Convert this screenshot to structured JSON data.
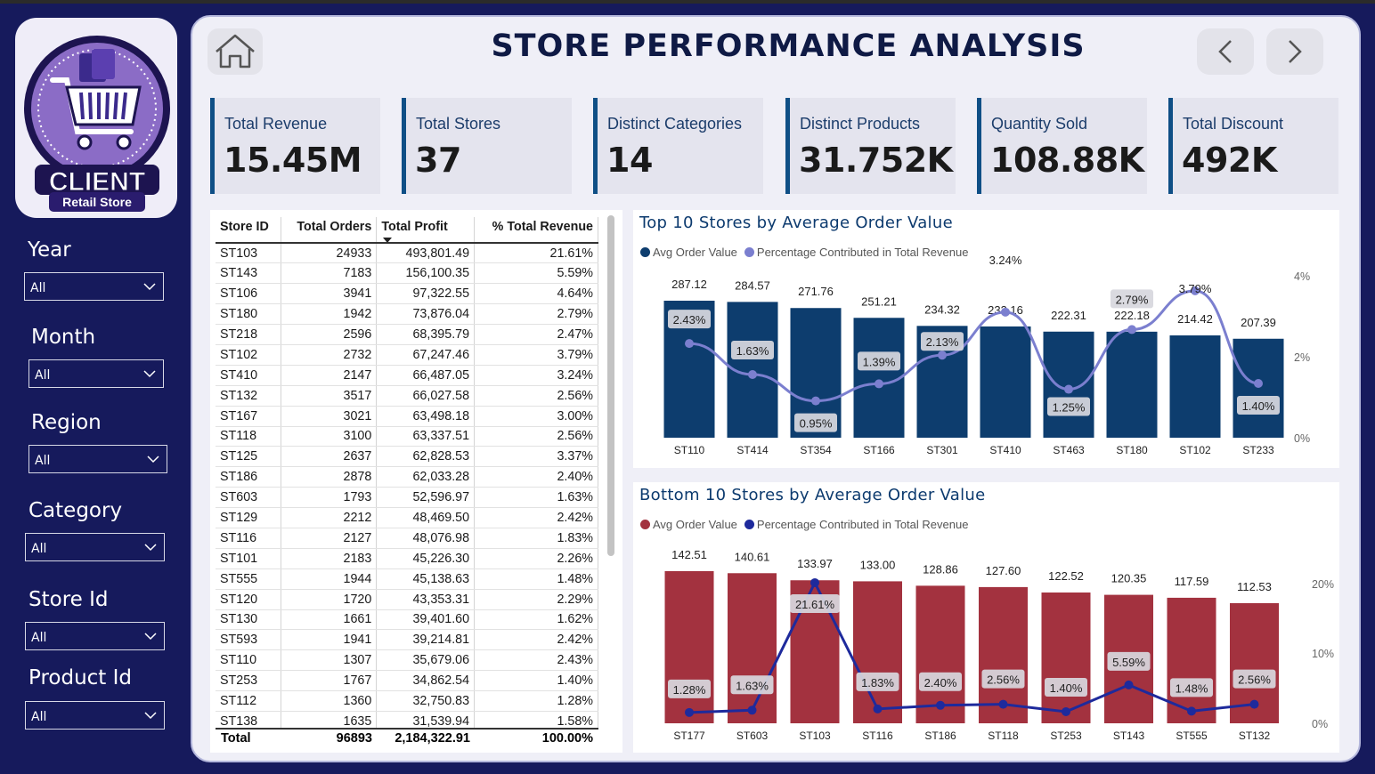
{
  "title": "STORE PERFORMANCE ANALYSIS",
  "logo": {
    "text": "CLIENT",
    "subtitle": "Retail Store"
  },
  "filters": [
    {
      "label": "Year",
      "value": "All"
    },
    {
      "label": "Month",
      "value": "All"
    },
    {
      "label": "Region",
      "value": "All"
    },
    {
      "label": "Category",
      "value": "All"
    },
    {
      "label": "Store Id",
      "value": "All"
    },
    {
      "label": "Product Id",
      "value": "All"
    }
  ],
  "kpis": [
    {
      "label": "Total Revenue",
      "value": "15.45M"
    },
    {
      "label": "Total Stores",
      "value": "37"
    },
    {
      "label": "Distinct Categories",
      "value": "14"
    },
    {
      "label": "Distinct Products",
      "value": "31.752K"
    },
    {
      "label": "Quantity Sold",
      "value": "108.88K"
    },
    {
      "label": "Total Discount",
      "value": "492K"
    }
  ],
  "table": {
    "columns": [
      "Store ID",
      "Total Orders",
      "Total Profit",
      "% Total Revenue"
    ],
    "rows": [
      [
        "ST103",
        "24933",
        "493,801.49",
        "21.61%"
      ],
      [
        "ST143",
        "7183",
        "156,100.35",
        "5.59%"
      ],
      [
        "ST106",
        "3941",
        "97,322.55",
        "4.64%"
      ],
      [
        "ST180",
        "1942",
        "73,876.04",
        "2.79%"
      ],
      [
        "ST218",
        "2596",
        "68,395.79",
        "2.47%"
      ],
      [
        "ST102",
        "2732",
        "67,247.46",
        "3.79%"
      ],
      [
        "ST410",
        "2147",
        "66,487.05",
        "3.24%"
      ],
      [
        "ST132",
        "3517",
        "66,027.58",
        "2.56%"
      ],
      [
        "ST167",
        "3021",
        "63,498.18",
        "3.00%"
      ],
      [
        "ST118",
        "3100",
        "63,337.51",
        "2.56%"
      ],
      [
        "ST125",
        "2637",
        "62,828.53",
        "3.37%"
      ],
      [
        "ST186",
        "2878",
        "62,033.28",
        "2.40%"
      ],
      [
        "ST603",
        "1793",
        "52,596.97",
        "1.63%"
      ],
      [
        "ST129",
        "2212",
        "48,469.50",
        "2.42%"
      ],
      [
        "ST116",
        "2127",
        "48,076.98",
        "1.83%"
      ],
      [
        "ST101",
        "2183",
        "45,226.30",
        "2.26%"
      ],
      [
        "ST555",
        "1944",
        "45,138.63",
        "1.48%"
      ],
      [
        "ST120",
        "1720",
        "43,353.31",
        "2.29%"
      ],
      [
        "ST130",
        "1661",
        "39,401.60",
        "1.62%"
      ],
      [
        "ST593",
        "1941",
        "39,214.81",
        "2.42%"
      ],
      [
        "ST110",
        "1307",
        "35,679.06",
        "2.43%"
      ],
      [
        "ST253",
        "1767",
        "34,862.54",
        "1.40%"
      ],
      [
        "ST112",
        "1360",
        "32,750.83",
        "1.28%"
      ],
      [
        "ST138",
        "1635",
        "31,539.94",
        "1.58%"
      ]
    ],
    "total": {
      "label": "Total",
      "orders": "96893",
      "profit": "2,184,322.91",
      "pct": "100.00%"
    }
  },
  "chart_data": [
    {
      "type": "bar",
      "title": "Top 10 Stores by Average Order Value",
      "categories": [
        "ST110",
        "ST414",
        "ST354",
        "ST166",
        "ST301",
        "ST410",
        "ST463",
        "ST180",
        "ST102",
        "ST233"
      ],
      "series": [
        {
          "name": "Avg Order Value",
          "type": "bar",
          "color": "#0d3d6e",
          "values": [
            287.12,
            284.57,
            271.76,
            251.21,
            234.32,
            233.16,
            222.31,
            222.18,
            214.42,
            207.39
          ]
        },
        {
          "name": "Percentage Contributed in Total Revenue",
          "type": "line",
          "color": "#7b7fcf",
          "values": [
            2.43,
            1.63,
            0.95,
            1.39,
            2.13,
            3.24,
            1.25,
            2.79,
            3.79,
            1.4
          ],
          "labels": [
            "2.43%",
            "1.63%",
            "0.95%",
            "1.39%",
            "2.13%",
            "3.24%",
            "1.25%",
            "2.79%",
            "3.79%",
            "1.40%"
          ]
        }
      ],
      "y2_ticks": [
        "4%",
        "2%",
        "0%"
      ],
      "y2lim": [
        0,
        4.2
      ],
      "legend": "top-left"
    },
    {
      "type": "bar",
      "title": "Bottom 10 Stores by Average Order Value",
      "categories": [
        "ST177",
        "ST603",
        "ST103",
        "ST116",
        "ST186",
        "ST118",
        "ST253",
        "ST143",
        "ST555",
        "ST132"
      ],
      "series": [
        {
          "name": "Avg Order Value",
          "type": "bar",
          "color": "#a3323f",
          "values": [
            142.51,
            140.61,
            133.97,
            133.0,
            128.86,
            127.6,
            122.52,
            120.35,
            117.59,
            112.53
          ]
        },
        {
          "name": "Percentage Contributed in Total Revenue",
          "type": "line",
          "color": "#1e2a9c",
          "values": [
            1.28,
            1.63,
            21.61,
            1.83,
            2.4,
            2.56,
            1.4,
            5.59,
            1.48,
            2.56
          ],
          "labels": [
            "1.28%",
            "1.63%",
            "21.61%",
            "1.83%",
            "2.40%",
            "2.56%",
            "1.40%",
            "5.59%",
            "1.48%",
            "2.56%"
          ]
        }
      ],
      "y2_ticks": [
        "20%",
        "10%",
        "0%"
      ],
      "y2lim": [
        0,
        23
      ],
      "legend": "top-left"
    }
  ]
}
